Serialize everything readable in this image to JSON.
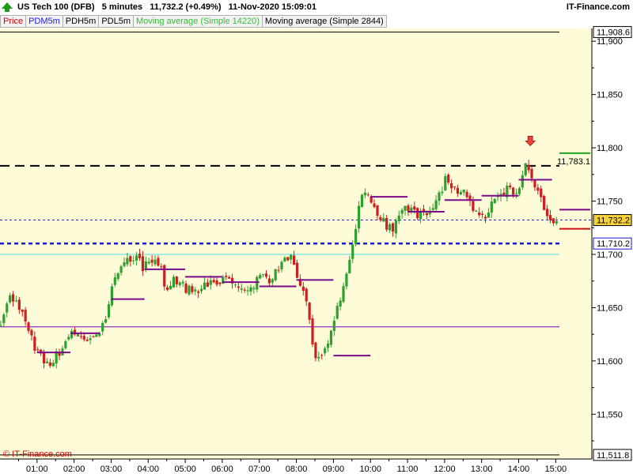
{
  "header": {
    "title": "US Tech 100 (DFB)   5 minutes   11,732.2 (+0.49%)   11-Nov-2020 15:09:01",
    "brand": "IT-Finance.com"
  },
  "legend": [
    {
      "label": "Price",
      "color": "#cc0000"
    },
    {
      "label": "PDM5m",
      "color": "#1a1aff"
    },
    {
      "label": "PDH5m",
      "color": "#000000"
    },
    {
      "label": "PDL5m",
      "color": "#000000"
    },
    {
      "label": "Moving average (Simple 14220)",
      "color": "#33bb33"
    },
    {
      "label": "Moving average (Simple 2844)",
      "color": "#000000"
    }
  ],
  "copyright": "© IT-Finance.com",
  "colors": {
    "background": "#fefbd9",
    "up": "#2da02d",
    "down": "#cc1f1f",
    "pivot": "#7a0a8a",
    "ma_long": "#8000c0",
    "ma_short": "#4fd8e6",
    "pdm": "#1a1ad0",
    "price_line": "#2b2bb0"
  },
  "chart_data": {
    "type": "candlestick",
    "title": "US Tech 100 (DFB)",
    "timeframe": "5 minutes",
    "ylim": [
      11508,
      11912
    ],
    "x_ticks": [
      "01:00",
      "02:00",
      "03:00",
      "04:00",
      "05:00",
      "06:00",
      "07:00",
      "08:00",
      "09:00",
      "10:00",
      "11:00",
      "12:00",
      "13:00",
      "14:00",
      "15:00"
    ],
    "x_tick_hours": [
      1,
      2,
      3,
      4,
      5,
      6,
      7,
      8,
      9,
      10,
      11,
      12,
      13,
      14,
      15
    ],
    "x_range_hours": [
      0.0,
      15.1
    ],
    "y_ticks": [
      11550,
      11600,
      11650,
      11700,
      11750,
      11800,
      11850,
      11900
    ],
    "y_tick_labels": [
      "11,550",
      "11,600",
      "11,650",
      "11,700",
      "11,750",
      "11,800",
      "11,850",
      "11,900"
    ],
    "session_high": {
      "value": 11908.6,
      "label": "11,908.6"
    },
    "session_low": {
      "value": 11511.8,
      "label": "11,511.8"
    },
    "pdh": {
      "value": 11783.1,
      "label": "11,783.1"
    },
    "pdm": {
      "value": 11710.2,
      "label": "11,710.2"
    },
    "last_price": {
      "value": 11732.2,
      "label": "11,732.2"
    },
    "moving_averages": [
      {
        "name": "Moving average (Simple 14220)",
        "value": 11700.0
      },
      {
        "name": "Moving average (Simple 2844)",
        "value": 11632.0
      }
    ],
    "right_marks": [
      {
        "color": "green",
        "value": 11795
      },
      {
        "color": "purple",
        "value": 11742
      },
      {
        "color": "red",
        "value": 11724
      }
    ],
    "signal_arrow": {
      "hour": 14.25,
      "value": 11802
    },
    "pivot_segments": [
      {
        "h0": 1.0,
        "h1": 1.9,
        "value": 11608
      },
      {
        "h0": 1.9,
        "h1": 2.7,
        "value": 11626
      },
      {
        "h0": 3.0,
        "h1": 3.9,
        "value": 11658
      },
      {
        "h0": 3.9,
        "h1": 5.0,
        "value": 11686
      },
      {
        "h0": 5.0,
        "h1": 6.0,
        "value": 11679
      },
      {
        "h0": 6.0,
        "h1": 7.0,
        "value": 11674
      },
      {
        "h0": 7.0,
        "h1": 8.0,
        "value": 11670
      },
      {
        "h0": 8.0,
        "h1": 9.0,
        "value": 11676
      },
      {
        "h0": 9.0,
        "h1": 10.0,
        "value": 11605
      },
      {
        "h0": 10.0,
        "h1": 11.0,
        "value": 11754
      },
      {
        "h0": 11.0,
        "h1": 12.0,
        "value": 11740
      },
      {
        "h0": 12.0,
        "h1": 13.0,
        "value": 11751
      },
      {
        "h0": 13.0,
        "h1": 14.0,
        "value": 11755
      },
      {
        "h0": 14.0,
        "h1": 14.9,
        "value": 11770
      }
    ],
    "close_path": [
      [
        0.0,
        11633
      ],
      [
        0.3,
        11660
      ],
      [
        0.6,
        11646
      ],
      [
        1.0,
        11608
      ],
      [
        1.3,
        11598
      ],
      [
        1.7,
        11610
      ],
      [
        2.0,
        11628
      ],
      [
        2.3,
        11618
      ],
      [
        2.6,
        11622
      ],
      [
        2.9,
        11640
      ],
      [
        3.0,
        11672
      ],
      [
        3.25,
        11690
      ],
      [
        3.5,
        11694
      ],
      [
        3.7,
        11702
      ],
      [
        3.85,
        11688
      ],
      [
        4.1,
        11696
      ],
      [
        4.3,
        11693
      ],
      [
        4.5,
        11662
      ],
      [
        4.7,
        11678
      ],
      [
        5.0,
        11668
      ],
      [
        5.3,
        11666
      ],
      [
        5.6,
        11674
      ],
      [
        5.9,
        11676
      ],
      [
        6.2,
        11678
      ],
      [
        6.5,
        11664
      ],
      [
        6.8,
        11670
      ],
      [
        7.0,
        11678
      ],
      [
        7.3,
        11676
      ],
      [
        7.6,
        11692
      ],
      [
        7.8,
        11700
      ],
      [
        8.0,
        11684
      ],
      [
        8.3,
        11648
      ],
      [
        8.5,
        11598
      ],
      [
        8.7,
        11608
      ],
      [
        8.9,
        11622
      ],
      [
        9.1,
        11648
      ],
      [
        9.3,
        11672
      ],
      [
        9.5,
        11705
      ],
      [
        9.7,
        11750
      ],
      [
        9.9,
        11758
      ],
      [
        10.1,
        11742
      ],
      [
        10.35,
        11730
      ],
      [
        10.6,
        11722
      ],
      [
        10.8,
        11744
      ],
      [
        11.0,
        11742
      ],
      [
        11.2,
        11738
      ],
      [
        11.45,
        11738
      ],
      [
        11.7,
        11746
      ],
      [
        11.9,
        11758
      ],
      [
        12.05,
        11772
      ],
      [
        12.3,
        11760
      ],
      [
        12.5,
        11758
      ],
      [
        12.75,
        11742
      ],
      [
        12.95,
        11736
      ],
      [
        13.1,
        11732
      ],
      [
        13.3,
        11748
      ],
      [
        13.5,
        11754
      ],
      [
        13.7,
        11762
      ],
      [
        13.9,
        11758
      ],
      [
        14.05,
        11768
      ],
      [
        14.2,
        11786
      ],
      [
        14.35,
        11772
      ],
      [
        14.5,
        11760
      ],
      [
        14.7,
        11740
      ],
      [
        14.9,
        11732
      ],
      [
        15.05,
        11732
      ]
    ]
  }
}
